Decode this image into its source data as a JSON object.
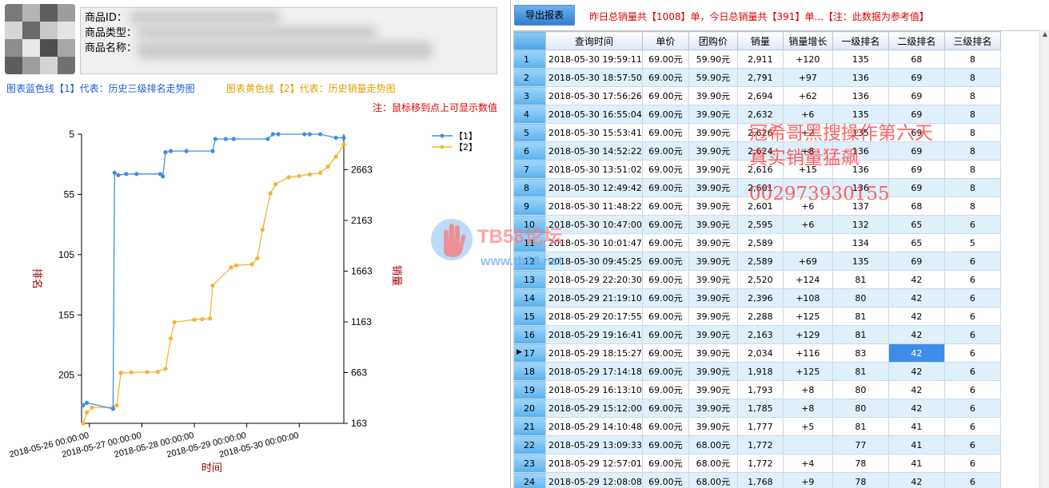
{
  "product": {
    "id_label": "商品ID：",
    "type_label": "商品类型：",
    "name_label": "商品名称："
  },
  "legends": {
    "line1": "图表蓝色线【1】代表：历史三级排名走势图",
    "line2": "图表黄色线【2】代表：历史销量走势图",
    "hint": "注：鼠标移到点上可显示数值"
  },
  "colors": {
    "blue_series": "#3d8ee8",
    "orange_series": "#f5b335",
    "alert_red": "#e00000"
  },
  "toolbar": {
    "export_label": "导出报表",
    "summary": "昨日总销量共【1008】单，今日总销量共【391】单...【注：此数据为参考值】"
  },
  "table": {
    "columns": [
      "查询时间",
      "单价",
      "团购价",
      "销量",
      "销量增长",
      "一级排名",
      "二级排名",
      "三级排名"
    ],
    "selected_row": 17,
    "selected_col": 6,
    "rows": [
      {
        "n": "1",
        "time": "2018-05-30 19:59:11",
        "price": "69.00元",
        "group": "59.90元",
        "sales": "2,911",
        "growth": "+120",
        "r1": "135",
        "r2": "68",
        "r3": "8"
      },
      {
        "n": "2",
        "time": "2018-05-30 18:57:50",
        "price": "69.00元",
        "group": "59.90元",
        "sales": "2,791",
        "growth": "+97",
        "r1": "136",
        "r2": "69",
        "r3": "8"
      },
      {
        "n": "3",
        "time": "2018-05-30 17:56:26",
        "price": "69.00元",
        "group": "39.90元",
        "sales": "2,694",
        "growth": "+62",
        "r1": "136",
        "r2": "69",
        "r3": "8"
      },
      {
        "n": "4",
        "time": "2018-05-30 16:55:04",
        "price": "69.00元",
        "group": "39.90元",
        "sales": "2,632",
        "growth": "+6",
        "r1": "135",
        "r2": "69",
        "r3": "8"
      },
      {
        "n": "5",
        "time": "2018-05-30 15:53:41",
        "price": "69.00元",
        "group": "39.90元",
        "sales": "2,626",
        "growth": "+2",
        "r1": "135",
        "r2": "69",
        "r3": "8"
      },
      {
        "n": "6",
        "time": "2018-05-30 14:52:22",
        "price": "69.00元",
        "group": "39.90元",
        "sales": "2,624",
        "growth": "+8",
        "r1": "136",
        "r2": "69",
        "r3": "8"
      },
      {
        "n": "7",
        "time": "2018-05-30 13:51:02",
        "price": "69.00元",
        "group": "39.90元",
        "sales": "2,616",
        "growth": "+15",
        "r1": "136",
        "r2": "69",
        "r3": "8"
      },
      {
        "n": "8",
        "time": "2018-05-30 12:49:42",
        "price": "69.00元",
        "group": "39.90元",
        "sales": "2,601",
        "growth": "",
        "r1": "136",
        "r2": "69",
        "r3": "8"
      },
      {
        "n": "9",
        "time": "2018-05-30 11:48:22",
        "price": "69.00元",
        "group": "39.90元",
        "sales": "2,601",
        "growth": "+6",
        "r1": "137",
        "r2": "68",
        "r3": "8"
      },
      {
        "n": "10",
        "time": "2018-05-30 10:47:00",
        "price": "69.00元",
        "group": "39.90元",
        "sales": "2,595",
        "growth": "+6",
        "r1": "132",
        "r2": "65",
        "r3": "6"
      },
      {
        "n": "11",
        "time": "2018-05-30 10:01:47",
        "price": "69.00元",
        "group": "39.90元",
        "sales": "2,589",
        "growth": "",
        "r1": "134",
        "r2": "65",
        "r3": "5"
      },
      {
        "n": "12",
        "time": "2018-05-30 09:45:25",
        "price": "69.00元",
        "group": "39.90元",
        "sales": "2,589",
        "growth": "+69",
        "r1": "135",
        "r2": "69",
        "r3": "6"
      },
      {
        "n": "13",
        "time": "2018-05-29 22:20:30",
        "price": "69.00元",
        "group": "39.90元",
        "sales": "2,520",
        "growth": "+124",
        "r1": "81",
        "r2": "42",
        "r3": "6"
      },
      {
        "n": "14",
        "time": "2018-05-29 21:19:10",
        "price": "69.00元",
        "group": "39.90元",
        "sales": "2,396",
        "growth": "+108",
        "r1": "80",
        "r2": "42",
        "r3": "6"
      },
      {
        "n": "15",
        "time": "2018-05-29 20:17:55",
        "price": "69.00元",
        "group": "39.90元",
        "sales": "2,288",
        "growth": "+125",
        "r1": "81",
        "r2": "42",
        "r3": "6"
      },
      {
        "n": "16",
        "time": "2018-05-29 19:16:41",
        "price": "69.00元",
        "group": "39.90元",
        "sales": "2,163",
        "growth": "+129",
        "r1": "81",
        "r2": "42",
        "r3": "6"
      },
      {
        "n": "17",
        "time": "2018-05-29 18:15:27",
        "price": "69.00元",
        "group": "39.90元",
        "sales": "2,034",
        "growth": "+116",
        "r1": "83",
        "r2": "42",
        "r3": "6"
      },
      {
        "n": "18",
        "time": "2018-05-29 17:14:18",
        "price": "69.00元",
        "group": "39.90元",
        "sales": "1,918",
        "growth": "+125",
        "r1": "81",
        "r2": "42",
        "r3": "6"
      },
      {
        "n": "19",
        "time": "2018-05-29 16:13:10",
        "price": "69.00元",
        "group": "39.90元",
        "sales": "1,793",
        "growth": "+8",
        "r1": "80",
        "r2": "42",
        "r3": "6"
      },
      {
        "n": "20",
        "time": "2018-05-29 15:12:00",
        "price": "69.00元",
        "group": "39.90元",
        "sales": "1,785",
        "growth": "+8",
        "r1": "80",
        "r2": "42",
        "r3": "6"
      },
      {
        "n": "21",
        "time": "2018-05-29 14:10:48",
        "price": "69.00元",
        "group": "39.90元",
        "sales": "1,777",
        "growth": "+5",
        "r1": "81",
        "r2": "41",
        "r3": "6"
      },
      {
        "n": "22",
        "time": "2018-05-29 13:09:33",
        "price": "69.00元",
        "group": "68.00元",
        "sales": "1,772",
        "growth": "",
        "r1": "77",
        "r2": "41",
        "r3": "6"
      },
      {
        "n": "23",
        "time": "2018-05-29 12:57:01",
        "price": "69.00元",
        "group": "68.00元",
        "sales": "1,772",
        "growth": "+4",
        "r1": "78",
        "r2": "41",
        "r3": "6"
      },
      {
        "n": "24",
        "time": "2018-05-29 12:08:08",
        "price": "69.00元",
        "group": "68.00元",
        "sales": "1,768",
        "growth": "+9",
        "r1": "78",
        "r2": "42",
        "r3": "6"
      }
    ]
  },
  "watermark": {
    "line1": "冠希哥黑搜操作第六天",
    "line2": "真实销量猛飙",
    "line3": "002973930155",
    "logo_text": "TB58论坛",
    "logo_url": "www.tb58.net"
  },
  "chart_data": {
    "type": "line",
    "xlabel": "时间",
    "ylabel_left": "排名",
    "ylabel_right": "销量",
    "left_axis": {
      "reversed": true,
      "ticks": [
        5,
        55,
        105,
        155,
        205
      ],
      "range": [
        5,
        245
      ]
    },
    "right_axis": {
      "ticks": [
        163,
        663,
        1163,
        1663,
        2163,
        2663
      ],
      "range": [
        163,
        3013
      ]
    },
    "x_ticks": [
      "2018-05-26 00:00:00",
      "2018-05-27 00:00:00",
      "2018-05-28 00:00:00",
      "2018-05-29 00:00:00",
      "2018-05-30 00:00:00"
    ],
    "x_range_days": [
      -0.15,
      4.85
    ],
    "legend_position": "top-right",
    "series": [
      {
        "name": "【1】",
        "axis": "left",
        "color": "#3d8ee8",
        "points": [
          [
            -0.12,
            230
          ],
          [
            -0.05,
            228
          ],
          [
            0.45,
            233
          ],
          [
            0.48,
            37
          ],
          [
            0.55,
            39
          ],
          [
            0.7,
            38
          ],
          [
            0.9,
            38
          ],
          [
            1.35,
            38
          ],
          [
            1.4,
            40
          ],
          [
            1.45,
            20
          ],
          [
            1.55,
            19
          ],
          [
            1.85,
            19
          ],
          [
            2.35,
            19
          ],
          [
            2.4,
            9
          ],
          [
            2.6,
            9
          ],
          [
            2.75,
            9
          ],
          [
            3.4,
            9
          ],
          [
            3.5,
            5
          ],
          [
            3.6,
            5
          ],
          [
            4.1,
            5
          ],
          [
            4.2,
            5
          ],
          [
            4.4,
            5
          ],
          [
            4.7,
            8
          ],
          [
            4.85,
            8
          ]
        ]
      },
      {
        "name": "【2】",
        "axis": "right",
        "color": "#f5b335",
        "points": [
          [
            -0.12,
            163
          ],
          [
            -0.05,
            270
          ],
          [
            0.05,
            320
          ],
          [
            0.45,
            320
          ],
          [
            0.52,
            340
          ],
          [
            0.6,
            660
          ],
          [
            0.8,
            665
          ],
          [
            1.1,
            668
          ],
          [
            1.3,
            670
          ],
          [
            1.45,
            700
          ],
          [
            1.55,
            1000
          ],
          [
            1.62,
            1160
          ],
          [
            2.0,
            1185
          ],
          [
            2.15,
            1190
          ],
          [
            2.3,
            1195
          ],
          [
            2.35,
            1520
          ],
          [
            2.7,
            1700
          ],
          [
            2.8,
            1720
          ],
          [
            3.1,
            1730
          ],
          [
            3.2,
            1790
          ],
          [
            3.3,
            2070
          ],
          [
            3.45,
            2430
          ],
          [
            3.55,
            2520
          ],
          [
            3.8,
            2589
          ],
          [
            4.0,
            2601
          ],
          [
            4.2,
            2616
          ],
          [
            4.4,
            2632
          ],
          [
            4.55,
            2694
          ],
          [
            4.7,
            2791
          ],
          [
            4.85,
            2911
          ]
        ]
      }
    ]
  }
}
